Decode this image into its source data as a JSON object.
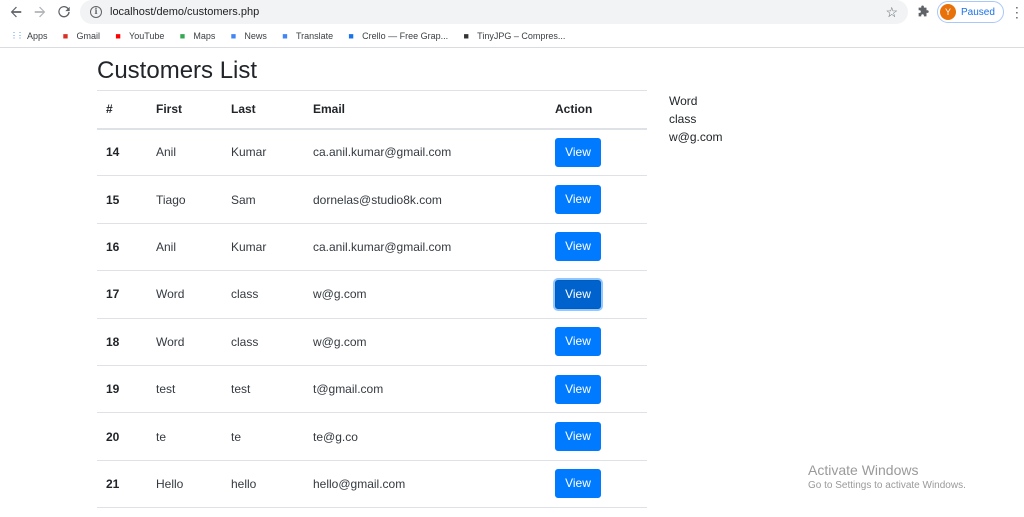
{
  "browser": {
    "url": "localhost/demo/customers.php",
    "profile_initial": "Y",
    "profile_status": "Paused",
    "bookmarks": [
      {
        "label": "Apps",
        "icon": "apps-grid-icon",
        "color": "#5f6368"
      },
      {
        "label": "Gmail",
        "icon": "gmail-icon",
        "color": "#d93025"
      },
      {
        "label": "YouTube",
        "icon": "youtube-icon",
        "color": "#ff0000"
      },
      {
        "label": "Maps",
        "icon": "maps-icon",
        "color": "#34a853"
      },
      {
        "label": "News",
        "icon": "news-icon",
        "color": "#4285f4"
      },
      {
        "label": "Translate",
        "icon": "translate-icon",
        "color": "#4285f4"
      },
      {
        "label": "Crello — Free Grap...",
        "icon": "crello-icon",
        "color": "#1a73e8"
      },
      {
        "label": "TinyJPG – Compres...",
        "icon": "tinyjpg-icon",
        "color": "#333333"
      }
    ]
  },
  "page": {
    "title": "Customers List",
    "columns": {
      "id": "#",
      "first": "First",
      "last": "Last",
      "email": "Email",
      "action": "Action"
    },
    "view_label": "View",
    "rows": [
      {
        "id": "14",
        "first": "Anil",
        "last": "Kumar",
        "email": "ca.anil.kumar@gmail.com"
      },
      {
        "id": "15",
        "first": "Tiago",
        "last": "Sam",
        "email": "dornelas@studio8k.com"
      },
      {
        "id": "16",
        "first": "Anil",
        "last": "Kumar",
        "email": "ca.anil.kumar@gmail.com"
      },
      {
        "id": "17",
        "first": "Word",
        "last": "class",
        "email": "w@g.com",
        "active": true
      },
      {
        "id": "18",
        "first": "Word",
        "last": "class",
        "email": "w@g.com"
      },
      {
        "id": "19",
        "first": "test",
        "last": "test",
        "email": "t@gmail.com"
      },
      {
        "id": "20",
        "first": "te",
        "last": "te",
        "email": "te@g.co"
      },
      {
        "id": "21",
        "first": "Hello",
        "last": "hello",
        "email": "hello@gmail.com"
      }
    ],
    "detail": {
      "first": "Word",
      "last": "class",
      "email": "w@g.com"
    }
  },
  "watermark": {
    "line1": "Activate Windows",
    "line2": "Go to Settings to activate Windows."
  },
  "colors": {
    "primary": "#007bff",
    "primary_active": "#0062cc"
  }
}
